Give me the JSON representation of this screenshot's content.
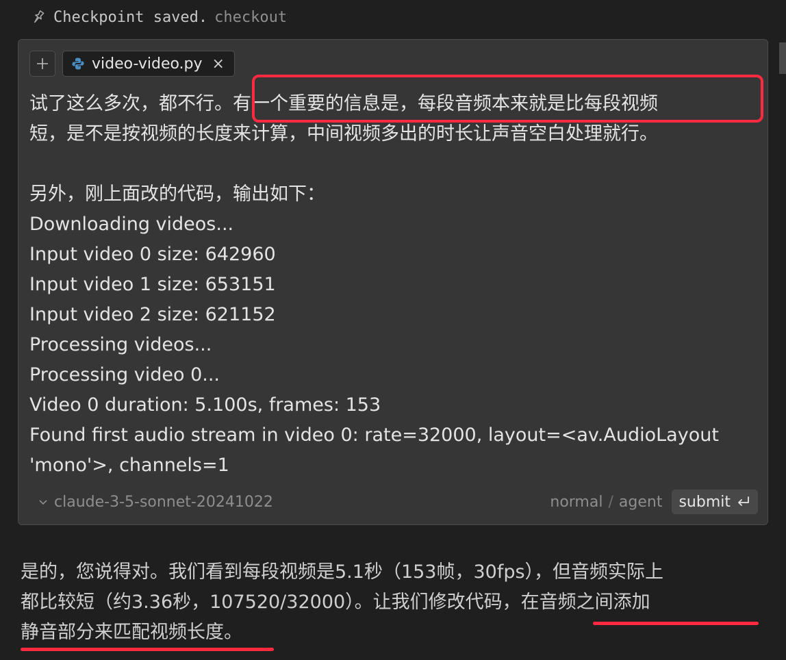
{
  "checkpoint": {
    "icon": "pin-icon",
    "text": "Checkpoint saved.",
    "action": "checkout"
  },
  "composer": {
    "add_icon": "plus-icon",
    "file_tab": {
      "icon": "python-icon",
      "name": "video-video.py",
      "close": "×"
    },
    "message_lines": [
      "试了这么多次，都不行。有一个重要的信息是，每段音频本来就是比每段视频",
      "短，是不是按视频的长度来计算，中间视频多出的时长让声音空白处理就行。",
      "",
      "另外，刚上面改的代码，输出如下：",
      "Downloading videos...",
      "Input video 0 size: 642960",
      "Input video 1 size: 653151",
      "Input video 2 size: 621152",
      "Processing videos...",
      "Processing video 0...",
      "Video 0 duration: 5.100s, frames: 153",
      "Found first audio stream in video 0: rate=32000, layout=<av.AudioLayout",
      "'mono'>, channels=1"
    ],
    "footer": {
      "model": "claude-3-5-sonnet-20241022",
      "mode_normal": "normal",
      "mode_sep": "/",
      "mode_agent": "agent",
      "submit": "submit"
    }
  },
  "response_lines": [
    "是的，您说得对。我们看到每段视频是5.1秒（153帧，30fps），但音频实际上",
    "都比较短（约3.36秒，107520/32000）。让我们修改代码，在音频之间添加",
    "静音部分来匹配视频长度。"
  ],
  "colors": {
    "background": "#1f1f1f",
    "panel": "#363636",
    "annotation": "#ff2a3f"
  }
}
